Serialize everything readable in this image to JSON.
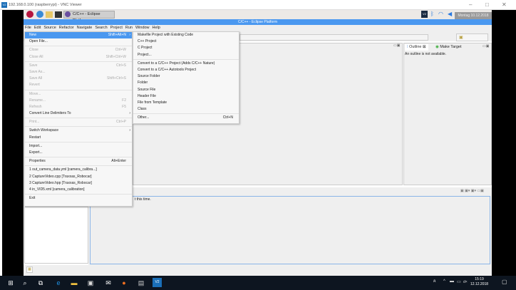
{
  "vnc": {
    "title": "192.168.0.100 (raspberrypi) - VNC Viewer",
    "icon": "V2"
  },
  "pi_panel": {
    "task_label": "C/C++ - Eclipse Platfo...",
    "tooltip": "Montag 10.12.2018",
    "vnc_icon": "V2"
  },
  "eclipse": {
    "title": "C/C++ - Eclipse Platform",
    "menubar": [
      "File",
      "Edit",
      "Source",
      "Refactor",
      "Navigate",
      "Search",
      "Project",
      "Run",
      "Window",
      "Help"
    ]
  },
  "file_menu": [
    {
      "label": "New",
      "shortcut": "Shift+Alt+N",
      "submenu": true,
      "selected": true
    },
    {
      "label": "Open File..."
    },
    {
      "sep": true
    },
    {
      "label": "Close",
      "shortcut": "Ctrl+W",
      "disabled": true
    },
    {
      "label": "Close All",
      "shortcut": "Shift+Ctrl+W",
      "disabled": true
    },
    {
      "sep": true
    },
    {
      "label": "Save",
      "shortcut": "Ctrl+S",
      "disabled": true
    },
    {
      "label": "Save As...",
      "disabled": true
    },
    {
      "label": "Save All",
      "shortcut": "Shift+Ctrl+S",
      "disabled": true
    },
    {
      "label": "Revert",
      "disabled": true
    },
    {
      "sep": true
    },
    {
      "label": "Move...",
      "disabled": true
    },
    {
      "label": "Rename...",
      "shortcut": "F2",
      "disabled": true
    },
    {
      "label": "Refresh",
      "shortcut": "F5",
      "disabled": true
    },
    {
      "label": "Convert Line Delimiters To",
      "submenu": true
    },
    {
      "sep": true
    },
    {
      "label": "Print...",
      "shortcut": "Ctrl+P",
      "disabled": true
    },
    {
      "sep": true
    },
    {
      "label": "Switch Workspace",
      "submenu": true
    },
    {
      "label": "Restart"
    },
    {
      "sep": true
    },
    {
      "label": "Import..."
    },
    {
      "label": "Export..."
    },
    {
      "sep": true
    },
    {
      "label": "Properties",
      "shortcut": "Alt+Enter"
    },
    {
      "sep": true
    },
    {
      "label": "1 out_camera_data.yml  [camera_calibra...]"
    },
    {
      "label": "2 CaptureVideo.cpp  [Traxxas_Robocar]"
    },
    {
      "label": "3 CaptureVideo.hpp  [Traxxas_Robocar]"
    },
    {
      "label": "4 in_VID5.xml  [camera_calibration]"
    },
    {
      "sep": true
    },
    {
      "label": "Exit"
    }
  ],
  "new_menu": [
    {
      "label": "Makefile Project with Existing Code"
    },
    {
      "label": "C++ Project"
    },
    {
      "label": "C Project"
    },
    {
      "label": "Project..."
    },
    {
      "sep": true
    },
    {
      "label": "Convert to a C/C++ Project (Adds C/C++ Nature)"
    },
    {
      "label": "Convert to a C/C++ Autotools Project"
    },
    {
      "label": "Source Folder"
    },
    {
      "label": "Folder"
    },
    {
      "label": "Source File"
    },
    {
      "label": "Header File"
    },
    {
      "label": "File from Template"
    },
    {
      "label": "Class"
    },
    {
      "sep": true
    },
    {
      "label": "Other...",
      "shortcut": "Ctrl+N"
    }
  ],
  "outline": {
    "tab1": "Outline",
    "tab2": "Make Target",
    "message": "An outline is not available."
  },
  "console": {
    "message": "t this time."
  },
  "taskbar": {
    "time": "15:19",
    "date": "12.12.2018",
    "vnc_label": "V2",
    "lang": "d×"
  }
}
